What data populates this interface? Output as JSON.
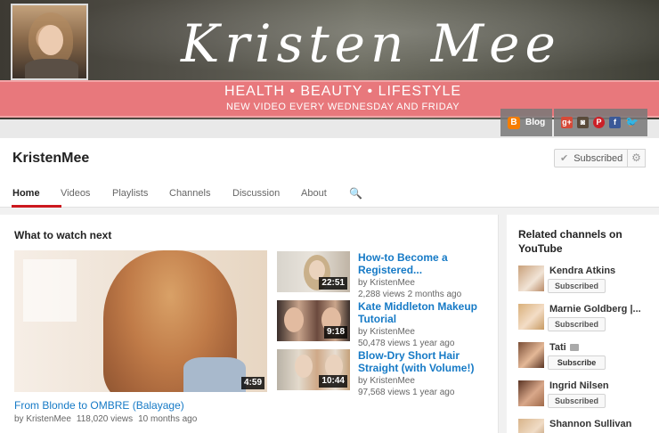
{
  "banner": {
    "logo_text": "Kristen Mee",
    "tagline": "HEALTH • BEAUTY • LIFESTYLE",
    "schedule": "NEW VIDEO EVERY WEDNESDAY AND FRIDAY",
    "blog_link": "Blog",
    "social_icons": [
      "google-plus-icon",
      "instagram-icon",
      "pinterest-icon",
      "facebook-icon",
      "twitter-icon"
    ]
  },
  "channel": {
    "name": "KristenMee",
    "subscribe_label": "Subscribed"
  },
  "tabs": [
    {
      "label": "Home",
      "active": true
    },
    {
      "label": "Videos",
      "active": false
    },
    {
      "label": "Playlists",
      "active": false
    },
    {
      "label": "Channels",
      "active": false
    },
    {
      "label": "Discussion",
      "active": false
    },
    {
      "label": "About",
      "active": false
    }
  ],
  "main": {
    "section_title": "What to watch next",
    "featured": {
      "title": "From Blonde to OMBRE (Balayage)",
      "duration": "4:59",
      "by": "by KristenMee",
      "views": "118,020 views",
      "age": "10 months ago"
    },
    "videos": [
      {
        "title": "How-to Become a Registered...",
        "duration": "22:51",
        "by": "by KristenMee",
        "meta": "2,288 views   2 months ago"
      },
      {
        "title": "Kate Middleton Makeup Tutorial",
        "duration": "9:18",
        "by": "by KristenMee",
        "meta": "50,478 views   1 year ago"
      },
      {
        "title": "Blow-Dry Short Hair Straight (with Volume!)",
        "duration": "10:44",
        "by": "by KristenMee",
        "meta": "97,568 views   1 year ago"
      }
    ]
  },
  "sidebar": {
    "title": "Related channels on YouTube",
    "channels": [
      {
        "name": "Kendra Atkins",
        "button": "Subscribed"
      },
      {
        "name": "Marnie Goldberg |...",
        "button": "Subscribed"
      },
      {
        "name": "Tati",
        "button": "Subscribe"
      },
      {
        "name": "Ingrid Nilsen",
        "button": "Subscribed"
      },
      {
        "name": "Shannon Sullivan",
        "button": ""
      }
    ]
  },
  "colors": {
    "accent_red": "#cc181e",
    "link_blue": "#167ac6",
    "ribbon_pink": "#e8787c"
  }
}
